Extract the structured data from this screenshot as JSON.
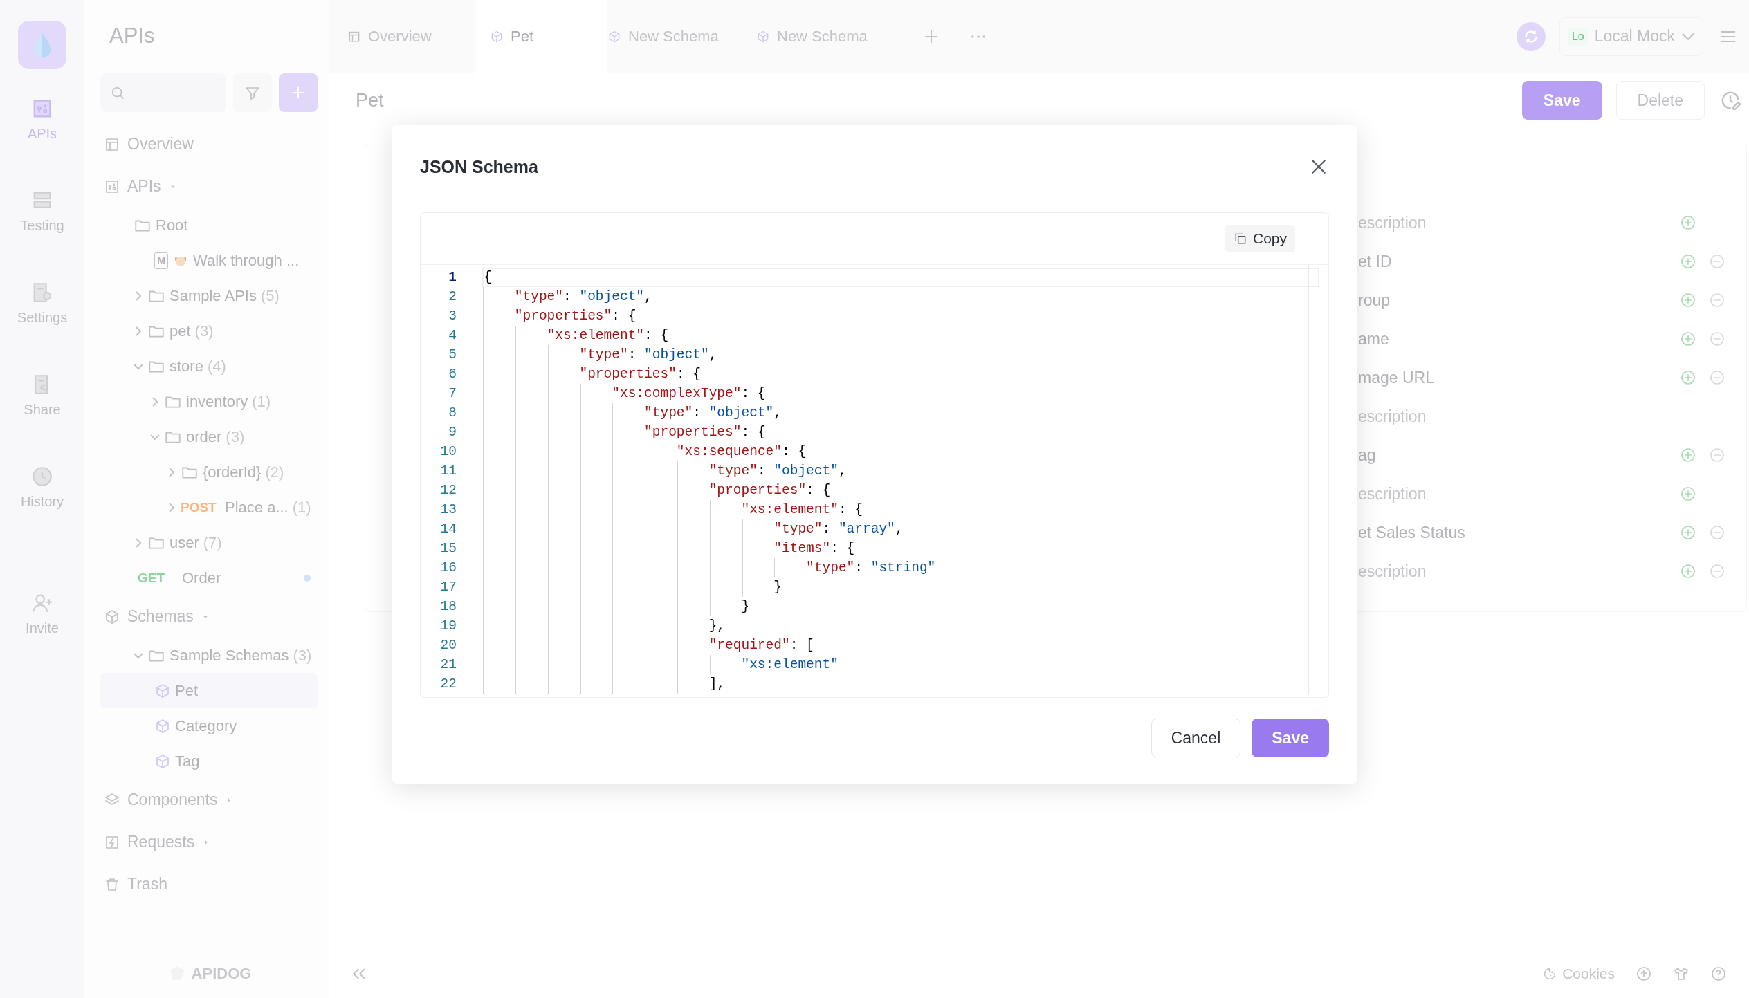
{
  "rail": {
    "items": [
      {
        "kind": "apis",
        "label": "APIs",
        "selected": true
      },
      {
        "kind": "testing",
        "label": "Testing",
        "selected": false
      },
      {
        "kind": "settings",
        "label": "Settings",
        "selected": false
      },
      {
        "kind": "share",
        "label": "Share",
        "selected": false
      },
      {
        "kind": "history",
        "label": "History",
        "selected": false
      },
      {
        "kind": "invite",
        "label": "Invite",
        "selected": false
      }
    ]
  },
  "sidebar": {
    "title": "APIs",
    "brand": "APIDOG",
    "sections": [
      {
        "kind": "overview",
        "label": "Overview"
      },
      {
        "kind": "apis",
        "label": "APIs",
        "expanded": true,
        "children": [
          {
            "kind": "root",
            "label": "Root",
            "children": [
              {
                "kind": "doc",
                "badge": "M",
                "label": "Walk through ..."
              }
            ]
          },
          {
            "kind": "folder",
            "label": "Sample APIs",
            "count": "(5)",
            "expanded": false
          },
          {
            "kind": "folder",
            "label": "pet",
            "count": "(3)",
            "expanded": false
          },
          {
            "kind": "folder",
            "label": "store",
            "count": "(4)",
            "expanded": true,
            "children": [
              {
                "kind": "folder",
                "label": "inventory",
                "count": "(1)",
                "expanded": false
              },
              {
                "kind": "folder",
                "label": "order",
                "count": "(3)",
                "expanded": true,
                "children": [
                  {
                    "kind": "folder",
                    "label": "{orderId}",
                    "count": "(2)",
                    "expanded": false
                  },
                  {
                    "kind": "endpoint",
                    "method": "POST",
                    "color": "#fbb57e",
                    "label": "Place a...",
                    "count": "(1)",
                    "expanded": false
                  }
                ]
              }
            ]
          },
          {
            "kind": "folder",
            "label": "user",
            "count": "(7)",
            "expanded": false
          },
          {
            "kind": "endpoint",
            "method": "GET",
            "color": "#8fd4a0",
            "label": "Order",
            "modified": true
          }
        ]
      },
      {
        "kind": "schemas",
        "label": "Schemas",
        "expanded": true,
        "children": [
          {
            "kind": "folder",
            "label": "Sample Schemas",
            "count": "(3)",
            "expanded": true,
            "children": [
              {
                "kind": "schema",
                "label": "Pet",
                "selected": true
              },
              {
                "kind": "schema",
                "label": "Category",
                "selected": false
              },
              {
                "kind": "schema",
                "label": "Tag",
                "selected": false
              }
            ]
          }
        ]
      },
      {
        "kind": "components",
        "label": "Components",
        "expanded": false
      },
      {
        "kind": "requests",
        "label": "Requests",
        "expanded": false
      },
      {
        "kind": "trash",
        "label": "Trash"
      }
    ]
  },
  "tabs": [
    {
      "kind": "overview",
      "label": "Overview",
      "selected": false
    },
    {
      "kind": "schema",
      "label": "Pet",
      "selected": true
    },
    {
      "kind": "schema",
      "label": "New Schema",
      "selected": false
    },
    {
      "kind": "schema",
      "label": "New Schema",
      "selected": false
    }
  ],
  "environment": {
    "badge": "Lo",
    "label": "Local Mock"
  },
  "page": {
    "title": "Pet",
    "buttons": [
      {
        "kind": "primary",
        "label": "Save"
      },
      {
        "kind": "default",
        "label": "Delete"
      }
    ]
  },
  "fields": [
    {
      "kind": "placeholder",
      "text": "escription",
      "add": true,
      "remove": false
    },
    {
      "kind": "name",
      "text": "et ID",
      "add": true,
      "remove": true
    },
    {
      "kind": "name",
      "text": "roup",
      "add": true,
      "remove": true
    },
    {
      "kind": "name",
      "text": "ame",
      "add": true,
      "remove": true
    },
    {
      "kind": "name",
      "text": "mage URL",
      "add": true,
      "remove": true
    },
    {
      "kind": "placeholder",
      "text": "escription",
      "add": false,
      "remove": false
    },
    {
      "kind": "name",
      "text": "ag",
      "add": true,
      "remove": true
    },
    {
      "kind": "placeholder",
      "text": "escription",
      "add": true,
      "remove": false
    },
    {
      "kind": "name",
      "text": "et Sales Status",
      "add": true,
      "remove": true
    },
    {
      "kind": "placeholder",
      "text": "escription",
      "add": true,
      "remove": true
    }
  ],
  "modal": {
    "title": "JSON Schema",
    "copy": "Copy",
    "lines": [
      {
        "n": "1",
        "code": "{",
        "current": true
      },
      {
        "n": "2",
        "code": "    \"type\": \"object\",",
        "current": false
      },
      {
        "n": "3",
        "code": "    \"properties\": {",
        "current": false
      },
      {
        "n": "4",
        "code": "        \"xs:element\": {",
        "current": false
      },
      {
        "n": "5",
        "code": "            \"type\": \"object\",",
        "current": false
      },
      {
        "n": "6",
        "code": "            \"properties\": {",
        "current": false
      },
      {
        "n": "7",
        "code": "                \"xs:complexType\": {",
        "current": false
      },
      {
        "n": "8",
        "code": "                    \"type\": \"object\",",
        "current": false
      },
      {
        "n": "9",
        "code": "                    \"properties\": {",
        "current": false
      },
      {
        "n": "10",
        "code": "                        \"xs:sequence\": {",
        "current": false
      },
      {
        "n": "11",
        "code": "                            \"type\": \"object\",",
        "current": false
      },
      {
        "n": "12",
        "code": "                            \"properties\": {",
        "current": false
      },
      {
        "n": "13",
        "code": "                                \"xs:element\": {",
        "current": false
      },
      {
        "n": "14",
        "code": "                                    \"type\": \"array\",",
        "current": false
      },
      {
        "n": "15",
        "code": "                                    \"items\": {",
        "current": false
      },
      {
        "n": "16",
        "code": "                                        \"type\": \"string\"",
        "current": false
      },
      {
        "n": "17",
        "code": "                                    }",
        "current": false
      },
      {
        "n": "18",
        "code": "                                }",
        "current": false
      },
      {
        "n": "19",
        "code": "                            },",
        "current": false
      },
      {
        "n": "20",
        "code": "                            \"required\": [",
        "current": false
      },
      {
        "n": "21",
        "code": "                                \"xs:element\"",
        "current": false
      },
      {
        "n": "22",
        "code": "                            ],",
        "current": false
      }
    ],
    "buttons": [
      {
        "kind": "default",
        "label": "Cancel"
      },
      {
        "kind": "primary",
        "label": "Save"
      }
    ]
  },
  "footer": {
    "links": [
      {
        "label": "Cookies"
      }
    ]
  }
}
